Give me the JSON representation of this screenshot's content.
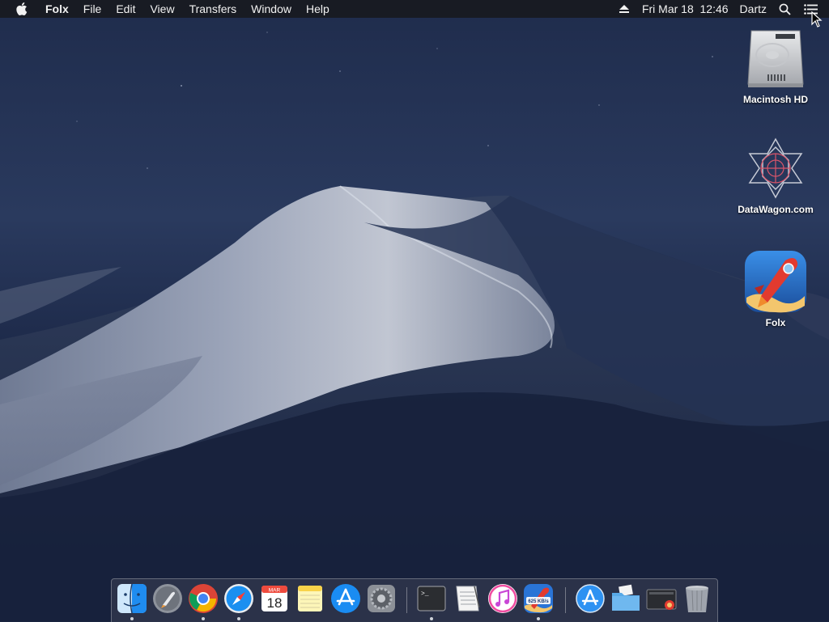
{
  "menubar": {
    "app_name": "Folx",
    "menus": [
      {
        "label": "File"
      },
      {
        "label": "Edit"
      },
      {
        "label": "View"
      },
      {
        "label": "Transfers"
      },
      {
        "label": "Window"
      },
      {
        "label": "Help"
      }
    ],
    "datetime": "Fri Mar 18  12:46",
    "user": "Dartz",
    "status_icons": [
      "eject-icon",
      "spotlight-search-icon",
      "notification-center-icon"
    ]
  },
  "desktop": {
    "icons": [
      {
        "label": "Macintosh HD",
        "icon": "hard-drive-icon"
      },
      {
        "label": "DataWagon.com",
        "icon": "network-volume-icon"
      },
      {
        "label": "Folx",
        "icon": "folx-rocket-icon"
      }
    ]
  },
  "dock": {
    "apps": [
      {
        "name": "Finder",
        "icon": "finder-icon",
        "running": true
      },
      {
        "name": "Launchpad",
        "icon": "launchpad-icon",
        "running": false
      },
      {
        "name": "Google Chrome",
        "icon": "chrome-icon",
        "running": true
      },
      {
        "name": "Safari",
        "icon": "safari-icon",
        "running": true
      },
      {
        "name": "Calendar",
        "icon": "calendar-icon",
        "running": false,
        "month": "MAR",
        "day": "18"
      },
      {
        "name": "Notes",
        "icon": "notes-icon",
        "running": false
      },
      {
        "name": "App Store",
        "icon": "app-store-icon",
        "running": false
      },
      {
        "name": "System Preferences",
        "icon": "system-preferences-icon",
        "running": false
      },
      {
        "name": "Terminal",
        "icon": "terminal-icon",
        "running": true,
        "prompt": ">_"
      },
      {
        "name": "TextEdit",
        "icon": "textedit-icon",
        "running": false
      },
      {
        "name": "iTunes",
        "icon": "itunes-icon",
        "running": false
      },
      {
        "name": "Folx",
        "icon": "folx-icon",
        "running": true,
        "badge": "625 KB/s"
      }
    ],
    "others": [
      {
        "name": "Applications",
        "icon": "applications-folder-icon"
      },
      {
        "name": "Documents",
        "icon": "documents-folder-icon"
      },
      {
        "name": "Downloads",
        "icon": "downloads-stack-icon"
      },
      {
        "name": "Trash",
        "icon": "trash-icon"
      }
    ]
  },
  "colors": {
    "menubar_bg": "#181a20",
    "sky_top": "#1c2a4a",
    "sky_bottom": "#101a33",
    "dune_light": "#8e97ad",
    "accent_blue": "#2d86ef"
  }
}
